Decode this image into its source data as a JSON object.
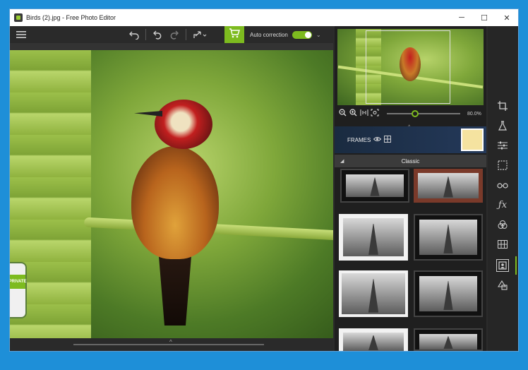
{
  "window": {
    "title": "Birds (2).jpg - Free Photo Editor",
    "minimize": "─",
    "maximize": "☐",
    "close": "✕"
  },
  "toolbar": {
    "menu_icon": "menu-icon",
    "undo_all_icon": "undo-all-icon",
    "undo_icon": "undo-icon",
    "redo_icon": "redo-icon",
    "share_icon": "share-icon",
    "cart_icon": "cart-icon",
    "auto_correction_label": "Auto correction",
    "auto_correction_on": true
  },
  "canvas": {
    "badge_text": "PRIVATE"
  },
  "preview": {
    "zoom_value": "80.0%",
    "zoom_level": 0.38
  },
  "frames": {
    "label": "FRAMES",
    "category": "Classic"
  },
  "sidebar": {
    "icons": [
      "crop-icon",
      "flask-icon",
      "sliders-icon",
      "selection-icon",
      "glasses-icon",
      "fx-icon",
      "circles-icon",
      "grid-icon",
      "frame-icon",
      "shapes-icon"
    ],
    "active": "frame-icon"
  },
  "colors": {
    "accent": "#7dbb1f",
    "titlebar": "#ffffff",
    "panel_bg": "#1f1f1f",
    "desktop": "#1e8fd8"
  }
}
